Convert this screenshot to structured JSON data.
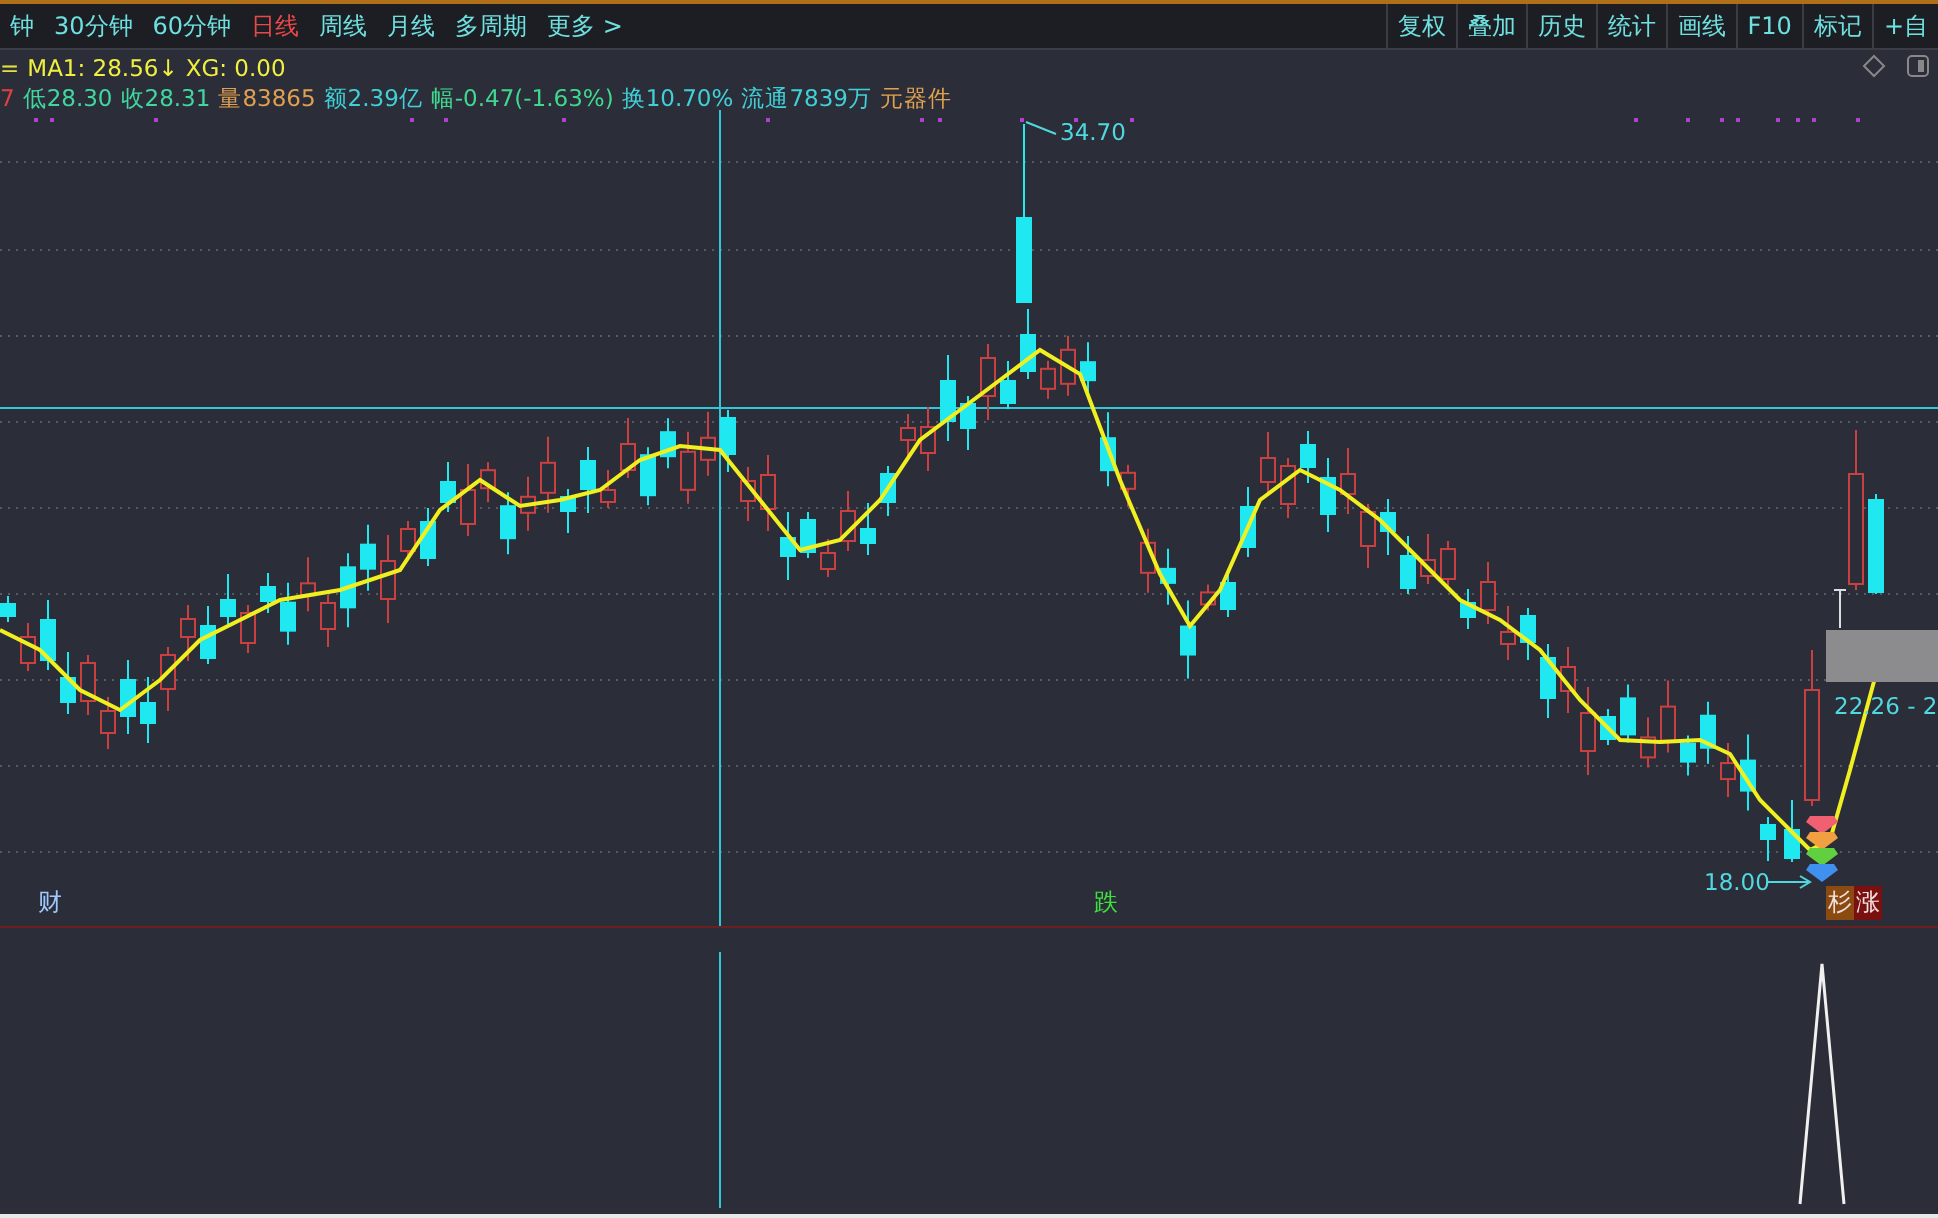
{
  "toolbar": {
    "periods": [
      {
        "label": "钟",
        "selected": false
      },
      {
        "label": "30分钟",
        "selected": false
      },
      {
        "label": "60分钟",
        "selected": false
      },
      {
        "label": "日线",
        "selected": true
      },
      {
        "label": "周线",
        "selected": false
      },
      {
        "label": "月线",
        "selected": false
      },
      {
        "label": "多周期",
        "selected": false
      },
      {
        "label": "更多 >",
        "selected": false
      }
    ],
    "tools": [
      "复权",
      "叠加",
      "历史",
      "统计",
      "画线",
      "F10",
      "标记",
      "+自"
    ]
  },
  "indicator_line": [
    {
      "text": "=",
      "color": "#e0e040"
    },
    {
      "text": "MA1: 28.56↓",
      "color": "#f0f040"
    },
    {
      "text": "XG: 0.00",
      "color": "#f0f040"
    }
  ],
  "quote_line": [
    {
      "text": "7",
      "color": "#e04040"
    },
    {
      "text": "低28.30",
      "color": "#40d8a0"
    },
    {
      "text": "收28.31",
      "color": "#40d8a0"
    },
    {
      "text": "量83865",
      "color": "#e0a050"
    },
    {
      "text": "额2.39亿",
      "color": "#40d0d8"
    },
    {
      "text": "幅-0.47(-1.63%)",
      "color": "#40d890"
    },
    {
      "text": "换10.70%",
      "color": "#40d0d8"
    },
    {
      "text": "流通7839万",
      "color": "#40d0d8"
    },
    {
      "text": "元器件",
      "color": "#e0a050"
    }
  ],
  "chart": {
    "high_label": "34.70",
    "low_label": "18.00",
    "range_label": "22.26 - 2",
    "signals": [
      {
        "text": "财",
        "kind": "finance"
      },
      {
        "text": "跌",
        "kind": "fall"
      }
    ],
    "end_badges": [
      {
        "text": "杉",
        "color": "#8a4a10"
      },
      {
        "text": "涨",
        "color": "#7a1010"
      }
    ]
  }
}
